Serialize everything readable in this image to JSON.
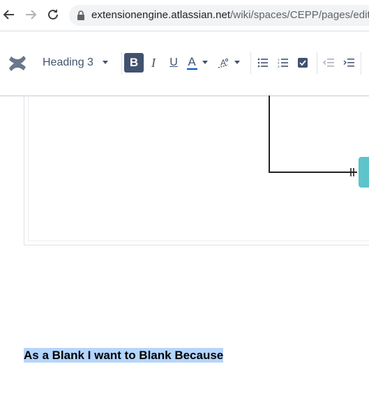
{
  "browser": {
    "url_host": "extensionengine.atlassian.net",
    "url_path": "/wiki/spaces/CEPP/pages/edit/"
  },
  "toolbar": {
    "text_style": "Heading 3",
    "bold_label": "B",
    "italic_label": "I",
    "underline_label": "U",
    "text_color_label": "A",
    "text_color_accent": "#0052cc"
  },
  "content": {
    "heading_text": "As a Blank I want to Blank Because"
  },
  "colors": {
    "node_teal": "#5dc4cc",
    "selection": "#b4d5fe"
  }
}
